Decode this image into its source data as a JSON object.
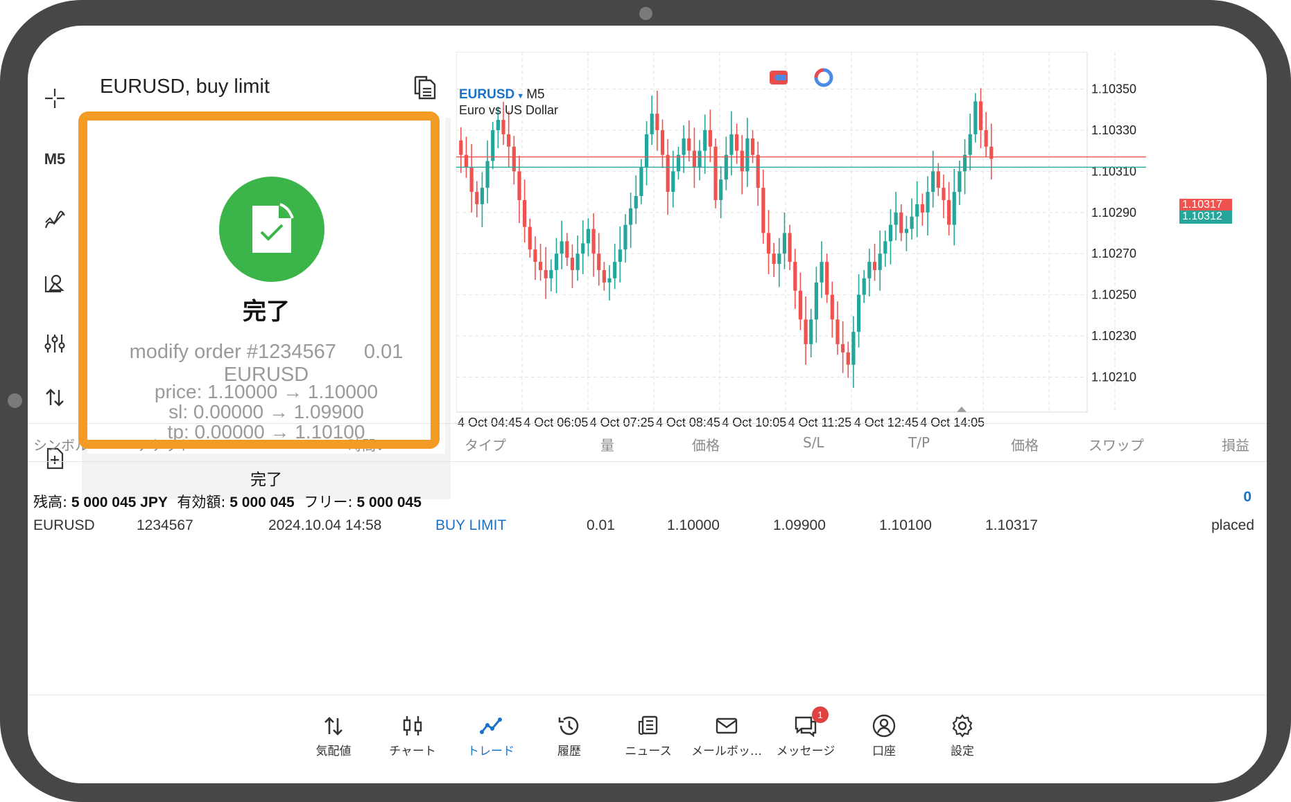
{
  "panel": {
    "title": "EURUSD, buy limit",
    "status_title": "完了",
    "order_label": "modify order #1234567",
    "volume_symbol": "0.01 EURUSD",
    "price_line": "price: 1.10000 → 1.10000",
    "sl_line": "sl: 0.00000 → 1.09900",
    "tp_line": "tp: 0.00000 → 1.10100",
    "done_button": "完了"
  },
  "toolbar": {
    "timeframe": "M5"
  },
  "chart": {
    "symbol": "EURUSD",
    "timeframe": "M5",
    "description": "Euro vs US Dollar",
    "bid_price": "1.10317",
    "ask_price": "1.10312",
    "colors": {
      "up": "#26a69a",
      "down": "#ef5350",
      "bid_line": "#ef5350",
      "ask_line": "#26a69a"
    }
  },
  "chart_data": {
    "type": "candlestick",
    "title": "",
    "y_ticks": [
      "1.10350",
      "1.10330",
      "1.10310",
      "1.10290",
      "1.10270",
      "1.10250",
      "1.10230",
      "1.10210"
    ],
    "x_ticks": [
      "4 Oct 04:45",
      "4 Oct 06:05",
      "4 Oct 07:25",
      "4 Oct 08:45",
      "4 Oct 10:05",
      "4 Oct 11:25",
      "4 Oct 12:45",
      "4 Oct 14:05"
    ],
    "ylim": [
      1.10193,
      1.10368
    ],
    "grid": true,
    "horizontal_lines": [
      {
        "label": "1.10317",
        "value": 1.10317,
        "color": "#ef5350"
      },
      {
        "label": "1.10312",
        "value": 1.10312,
        "color": "#26a69a"
      }
    ]
  },
  "table": {
    "headers": [
      "シンボル",
      "チケット",
      "時間",
      "タイプ",
      "量",
      "価格",
      "S/L",
      "T/P",
      "価格",
      "スワップ",
      "損益"
    ],
    "balance_label": "残高:",
    "balance_value": "5 000 045 JPY",
    "equity_label": "有効額:",
    "equity_value": "5 000 045",
    "free_label": "フリー:",
    "free_value": "5 000 045",
    "total_profit": "0",
    "rows": [
      {
        "symbol": "EURUSD",
        "ticket": "1234567",
        "time": "2024.10.04 14:58",
        "type": "BUY LIMIT",
        "volume": "0.01",
        "price": "1.10000",
        "sl": "1.09900",
        "tp": "1.10100",
        "current_price": "1.10317",
        "swap": "",
        "profit": "placed"
      }
    ]
  },
  "nav": {
    "items": [
      {
        "label": "気配値",
        "icon": "quotes-icon"
      },
      {
        "label": "チャート",
        "icon": "chart-icon"
      },
      {
        "label": "トレード",
        "icon": "trade-icon"
      },
      {
        "label": "履歴",
        "icon": "history-icon"
      },
      {
        "label": "ニュース",
        "icon": "news-icon"
      },
      {
        "label": "メールボッ…",
        "icon": "mail-icon"
      },
      {
        "label": "メッセージ",
        "icon": "messages-icon"
      },
      {
        "label": "口座",
        "icon": "account-icon"
      },
      {
        "label": "設定",
        "icon": "settings-icon"
      }
    ],
    "messages_badge": "1",
    "active_label": "トレード"
  }
}
